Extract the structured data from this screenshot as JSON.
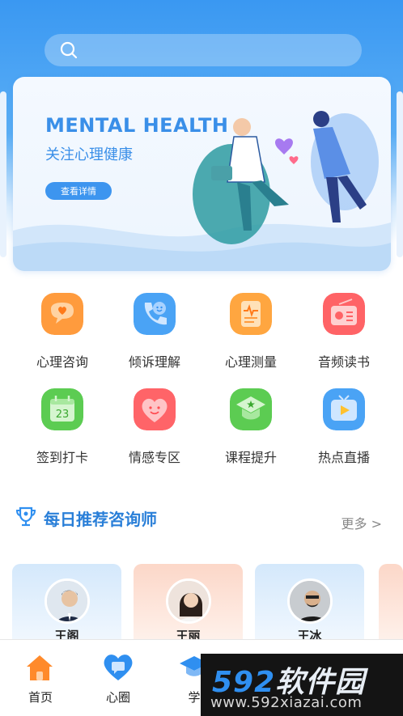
{
  "search": {
    "placeholder": ""
  },
  "banner": {
    "title": "MENTAL HEALTH",
    "subtitle": "关注心理健康",
    "button_label": "查看详情"
  },
  "grid": [
    {
      "label": "心理咨询",
      "icon": "chat-bubble-heart-icon",
      "color": "#ff9b3d"
    },
    {
      "label": "倾诉理解",
      "icon": "phone-smile-icon",
      "color": "#4aa3f5"
    },
    {
      "label": "心理测量",
      "icon": "clipboard-pulse-icon",
      "color": "#ffa640"
    },
    {
      "label": "音频读书",
      "icon": "radio-icon",
      "color": "#ff6366"
    },
    {
      "label": "签到打卡",
      "icon": "calendar-23-icon",
      "color": "#5ccc52"
    },
    {
      "label": "情感专区",
      "icon": "heart-smile-icon",
      "color": "#ff6468"
    },
    {
      "label": "课程提升",
      "icon": "graduation-cap-icon",
      "color": "#5ccc52"
    },
    {
      "label": "热点直播",
      "icon": "tv-play-icon",
      "color": "#4aa3f5"
    }
  ],
  "section": {
    "title": "每日推荐咨询师",
    "more_label": "更多 >",
    "icon": "trophy-icon"
  },
  "counselors": [
    {
      "name": "王阁",
      "color": "#d4e8fb"
    },
    {
      "name": "王丽",
      "color": "#fcd7c8"
    },
    {
      "name": "王冰",
      "color": "#d4e8fb"
    }
  ],
  "tabs": [
    {
      "label": "首页",
      "icon": "home-icon",
      "color": "#ff8a2b"
    },
    {
      "label": "心圈",
      "icon": "heart-chat-icon",
      "color": "#2f8ff0"
    },
    {
      "label": "学",
      "icon": "graduation-cap-icon",
      "color": "#2f8ff0"
    }
  ],
  "watermark": {
    "logo_a": "592",
    "logo_b": "软件园",
    "url": "www.592xiazai.com"
  }
}
